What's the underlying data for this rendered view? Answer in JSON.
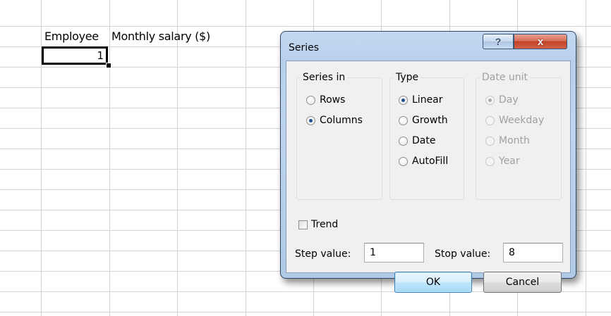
{
  "sheet": {
    "header_a": "Employee",
    "header_b": "Monthly salary ($)",
    "cell_a2": "1"
  },
  "dialog": {
    "title": "Series",
    "help_glyph": "?",
    "close_glyph": "x",
    "series_in": {
      "label": "Series in",
      "options": [
        "Rows",
        "Columns"
      ],
      "selected": "Columns"
    },
    "type": {
      "label": "Type",
      "options": [
        "Linear",
        "Growth",
        "Date",
        "AutoFill"
      ],
      "selected": "Linear"
    },
    "date_unit": {
      "label": "Date unit",
      "options": [
        "Day",
        "Weekday",
        "Month",
        "Year"
      ],
      "selected": "Day",
      "enabled": false
    },
    "trend": {
      "label": "Trend",
      "checked": false
    },
    "step_value": {
      "label": "Step value:",
      "value": "1"
    },
    "stop_value": {
      "label": "Stop value:",
      "value": "8"
    },
    "ok_label": "OK",
    "cancel_label": "Cancel"
  },
  "colors": {
    "grid": "#d4d4d4",
    "dialog_frame": "#b8d0ec",
    "close_button": "#c14327",
    "radio_dot": "#1e4f91"
  }
}
